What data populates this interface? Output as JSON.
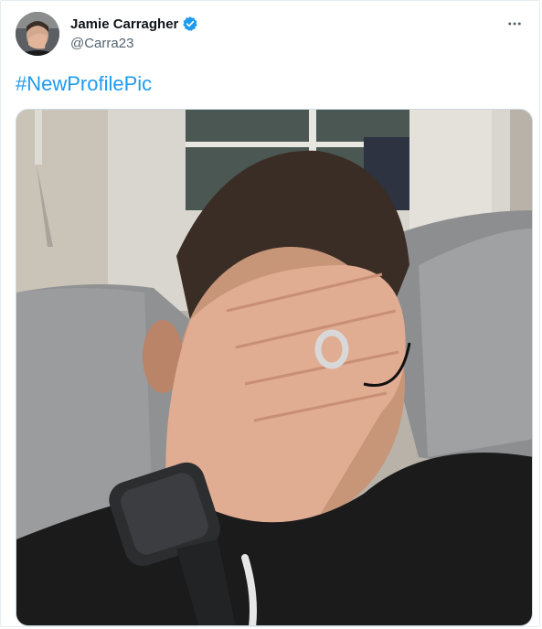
{
  "tweet": {
    "author_name": "Jamie Carragher",
    "author_handle": "@Carra23",
    "verified": true,
    "text": "#NewProfilePic",
    "more_icon": "more-horizontal-icon"
  },
  "colors": {
    "accent": "#1d9bf0",
    "text_primary": "#0f1419",
    "text_secondary": "#536471",
    "border": "#cfd9de"
  }
}
